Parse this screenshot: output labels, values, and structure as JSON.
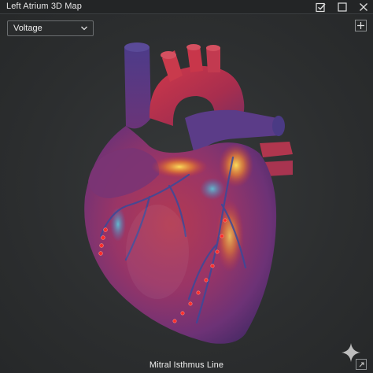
{
  "window": {
    "title": "Left Atrium 3D Map"
  },
  "toolbar": {
    "map_type_selected": "Voltage"
  },
  "status": {
    "ablation_line_label": "Mitral Isthmus Line"
  },
  "icons": {
    "confirm": "checkbox-check-icon",
    "maximize": "square-icon",
    "close": "close-icon",
    "add": "plus-icon",
    "dropdown": "chevron-down-icon",
    "resize": "resize-corner-icon"
  },
  "colors": {
    "titlebar_bg": "#232526",
    "viewport_bg": "#2c2e2f",
    "heart_tissue": "#8a3a6e",
    "voltage_high": "#c8242c",
    "voltage_mid": "#f2c232",
    "voltage_low": "#3aa0c8",
    "ablation_point": "#ff2a2a"
  }
}
